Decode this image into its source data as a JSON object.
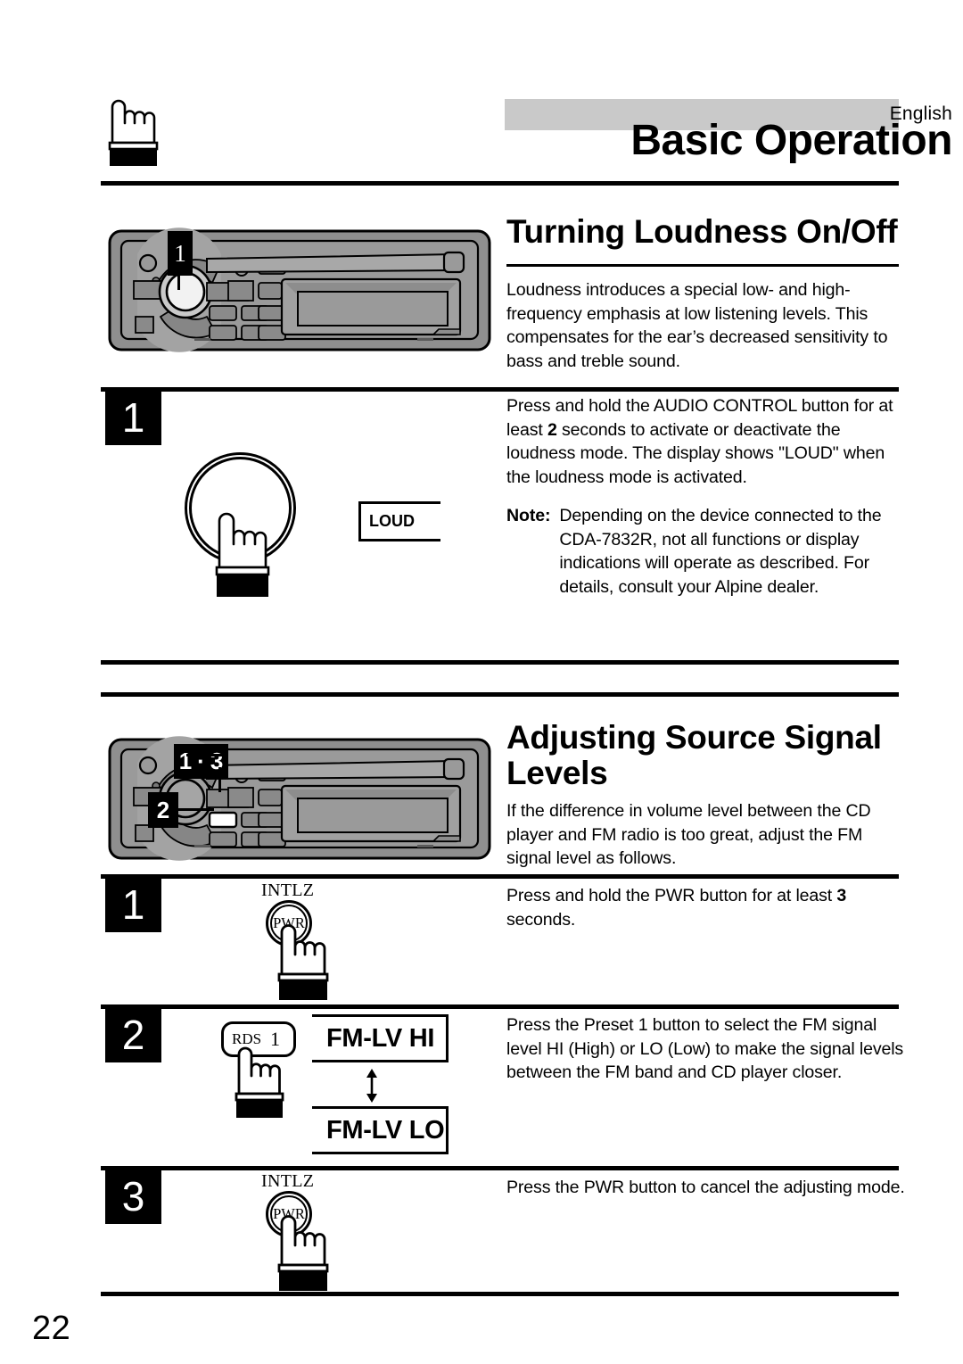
{
  "header": {
    "language": "English",
    "title": "Basic Operation"
  },
  "sections": [
    {
      "heading": "Turning Loudness On/Off",
      "intro": "Loudness introduces a special low- and high-frequency emphasis at low listening levels. This compensates for the ear’s decreased sensitivity to bass and treble sound.",
      "steps": [
        {
          "number": "1",
          "text_parts": [
            "Press and hold the AUDIO CONTROL button for at least ",
            "2",
            " seconds to activate or deactivate the loudness mode. The display shows \"LOUD\" when the loudness mode is activated."
          ],
          "note_label": "Note:",
          "note_text": "Depending on the device connected to the CDA-7832R, not all functions or display indications will operate as described. For details, consult your Alpine dealer.",
          "display": "LOUD"
        }
      ],
      "unit_callouts": [
        "1"
      ]
    },
    {
      "heading_line1": "Adjusting Source Signal",
      "heading_line2": "Levels",
      "intro": "If the difference in volume level between the CD player and FM radio is too great, adjust the FM signal level as follows.",
      "unit_callouts": [
        "1",
        "·",
        "3",
        "2"
      ],
      "steps": [
        {
          "number": "1",
          "text_parts": [
            "Press and hold the PWR button for at least ",
            "3",
            " seconds."
          ],
          "key_top_label": "INTLZ",
          "key_label": "PWR"
        },
        {
          "number": "2",
          "text_parts": [
            "Press the Preset 1 button to select the FM signal level HI (High) or LO (Low) to make the signal levels between the FM band and CD player closer.",
            "",
            ""
          ],
          "key_label_left": "RDS",
          "key_label_right": "1",
          "display_hi": "FM-LV HI",
          "display_lo": "FM-LV LO"
        },
        {
          "number": "3",
          "text_parts": [
            "Press the PWR button to cancel the adjusting mode.",
            "",
            ""
          ],
          "key_top_label": "INTLZ",
          "key_label": "PWR"
        }
      ]
    }
  ],
  "page_number": "22",
  "colors": {
    "band": "#c9c9c9",
    "ink": "#000000",
    "unit_body": "#8c8c8c",
    "unit_dark": "#5a5a5a"
  }
}
